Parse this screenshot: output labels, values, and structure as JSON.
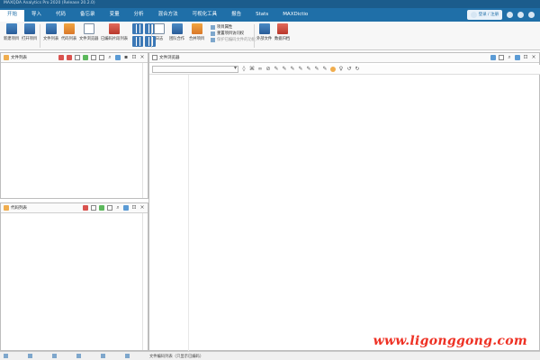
{
  "window": {
    "title": "MAXQDA Analytics Pro 2020 (Release 20.2.0)"
  },
  "menu": {
    "items": [
      {
        "label": "开始",
        "active": true
      },
      {
        "label": "导入",
        "active": false
      },
      {
        "label": "代码",
        "active": false
      },
      {
        "label": "备忘录",
        "active": false
      },
      {
        "label": "变量",
        "active": false
      },
      {
        "label": "分析",
        "active": false
      },
      {
        "label": "混合方法",
        "active": false
      },
      {
        "label": "可视化工具",
        "active": false
      },
      {
        "label": "报告",
        "active": false
      },
      {
        "label": "Stats",
        "active": false
      },
      {
        "label": "MAXDictio",
        "active": false
      }
    ],
    "login_label": "登录 / 注册"
  },
  "ribbon": {
    "buttons": [
      {
        "label": "新建项目",
        "icon": "new-project-icon"
      },
      {
        "label": "打开项目",
        "icon": "open-project-icon"
      },
      {
        "label": "文件列表",
        "icon": "document-list-icon"
      },
      {
        "label": "代码列表",
        "icon": "code-list-icon"
      },
      {
        "label": "文件浏览器",
        "icon": "document-browser-icon"
      },
      {
        "label": "已编码片段列表",
        "icon": "retrieved-segments-icon"
      },
      {
        "label": "日志",
        "icon": "logbook-icon"
      },
      {
        "label": "团队合作",
        "icon": "teamwork-icon"
      },
      {
        "label": "合并项目",
        "icon": "merge-projects-icon"
      },
      {
        "label": "外部文件",
        "icon": "external-files-icon"
      },
      {
        "label": "数据归档",
        "icon": "archive-icon"
      }
    ],
    "list_items": [
      {
        "label": "项目属性",
        "disabled": false
      },
      {
        "label": "重置项目访问权",
        "disabled": false
      },
      {
        "label": "保护已编码文件的功能",
        "disabled": true
      }
    ]
  },
  "panels": {
    "document_system": {
      "title": "文件列表"
    },
    "code_system": {
      "title": "代码列表"
    },
    "document_browser": {
      "title": "文件浏览器"
    }
  },
  "statusbar": {
    "text": "文件编码列表（只显示已编码）"
  },
  "watermark": "www.ligonggong.com"
}
